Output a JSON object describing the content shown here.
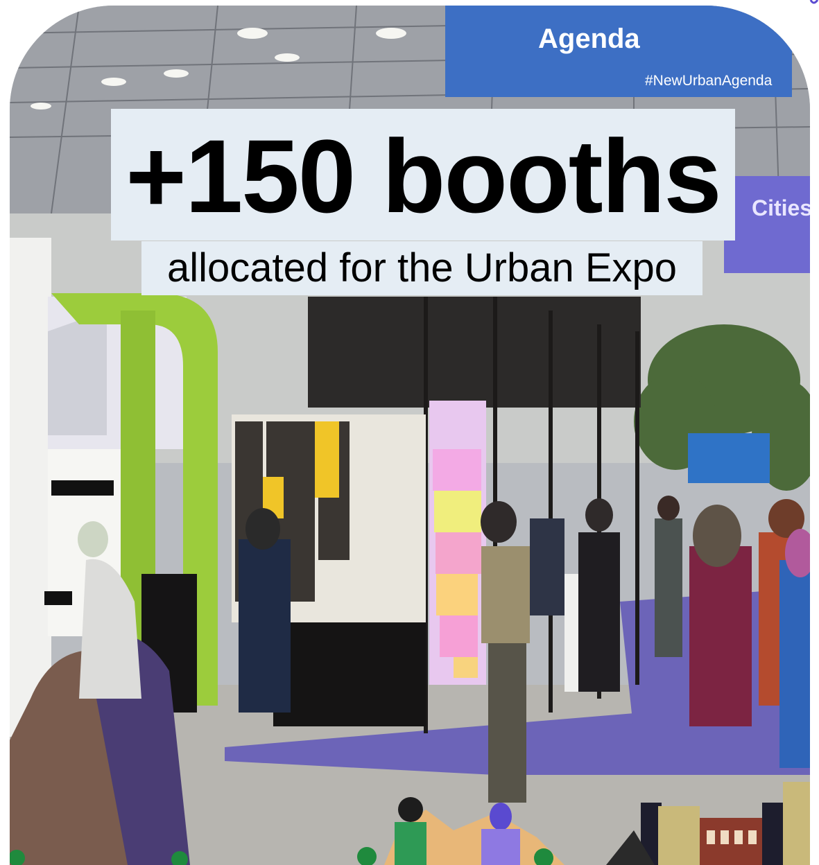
{
  "headline": {
    "main": "+150 booths",
    "sub": "allocated for the Urban Expo"
  },
  "photo": {
    "banner_title": "Agenda",
    "banner_hashtag": "#NewUrbanAgenda",
    "side_banner": "Cities"
  },
  "colors": {
    "headline_bg": "#e5edf4",
    "carpet": "#6c64b8",
    "banner_blue": "#3d6fc4",
    "banner_purple": "#6f6ad0",
    "booth_green": "#9ccc3c"
  }
}
